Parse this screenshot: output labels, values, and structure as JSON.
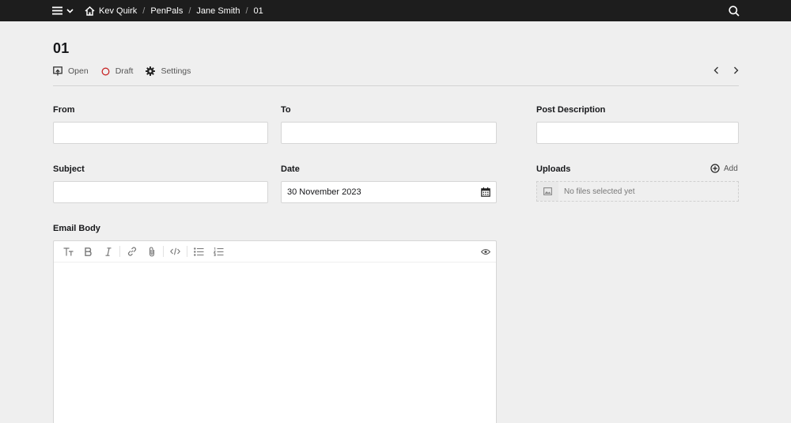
{
  "topbar": {
    "breadcrumbs": [
      "Kev Quirk",
      "PenPals",
      "Jane Smith",
      "01"
    ]
  },
  "page": {
    "title": "01",
    "actions": {
      "open": "Open",
      "draft": "Draft",
      "settings": "Settings"
    }
  },
  "form": {
    "from": {
      "label": "From",
      "value": ""
    },
    "to": {
      "label": "To",
      "value": ""
    },
    "post_description": {
      "label": "Post Description",
      "value": ""
    },
    "subject": {
      "label": "Subject",
      "value": ""
    },
    "date": {
      "label": "Date",
      "value": "30 November 2023"
    },
    "uploads": {
      "label": "Uploads",
      "add_label": "Add",
      "empty_text": "No files selected yet"
    },
    "email_body": {
      "label": "Email Body",
      "value": ""
    }
  },
  "icons": [
    "menu-icon",
    "chevron-down-icon",
    "home-icon",
    "search-icon",
    "open-icon",
    "draft-status-icon",
    "gear-icon",
    "chevron-left-icon",
    "chevron-right-icon",
    "calendar-icon",
    "add-circle-icon",
    "image-icon",
    "headings-icon",
    "bold-icon",
    "italic-icon",
    "link-icon",
    "attachment-icon",
    "code-icon",
    "bullet-list-icon",
    "ordered-list-icon",
    "eye-icon"
  ],
  "colors": {
    "topbar": "#1d1d1d",
    "background": "#efefef",
    "draft_status": "#c82829"
  }
}
